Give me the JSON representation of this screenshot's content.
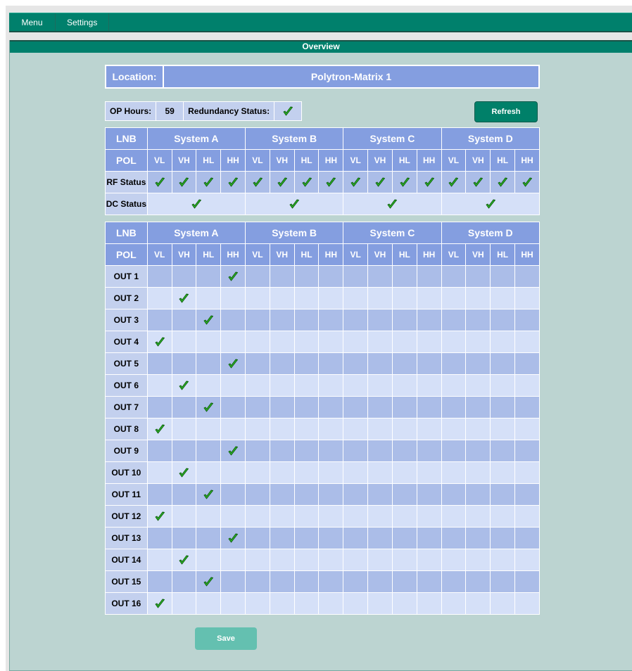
{
  "menu": {
    "items": [
      "Menu",
      "Settings"
    ]
  },
  "panel": {
    "title": "Overview"
  },
  "location": {
    "label": "Location:",
    "value": "Polytron-Matrix 1"
  },
  "info": {
    "op_hours_label": "OP Hours:",
    "op_hours_value": "59",
    "redundancy_label": "Redundancy Status:",
    "redundancy_ok": true,
    "refresh_label": "Refresh"
  },
  "systems": [
    "System A",
    "System B",
    "System C",
    "System D"
  ],
  "pols": [
    "VL",
    "VH",
    "HL",
    "HH"
  ],
  "labels": {
    "lnb": "LNB",
    "pol": "POL",
    "rf_status": "RF Status",
    "dc_status": "DC Status"
  },
  "rf_status": [
    [
      true,
      true,
      true,
      true
    ],
    [
      true,
      true,
      true,
      true
    ],
    [
      true,
      true,
      true,
      true
    ],
    [
      true,
      true,
      true,
      true
    ]
  ],
  "dc_status": [
    true,
    true,
    true,
    true
  ],
  "outputs": [
    {
      "label": "OUT 1",
      "system": 0,
      "pol": 3
    },
    {
      "label": "OUT 2",
      "system": 0,
      "pol": 1
    },
    {
      "label": "OUT 3",
      "system": 0,
      "pol": 2
    },
    {
      "label": "OUT 4",
      "system": 0,
      "pol": 0
    },
    {
      "label": "OUT 5",
      "system": 0,
      "pol": 3
    },
    {
      "label": "OUT 6",
      "system": 0,
      "pol": 1
    },
    {
      "label": "OUT 7",
      "system": 0,
      "pol": 2
    },
    {
      "label": "OUT 8",
      "system": 0,
      "pol": 0
    },
    {
      "label": "OUT 9",
      "system": 0,
      "pol": 3
    },
    {
      "label": "OUT 10",
      "system": 0,
      "pol": 1
    },
    {
      "label": "OUT 11",
      "system": 0,
      "pol": 2
    },
    {
      "label": "OUT 12",
      "system": 0,
      "pol": 0
    },
    {
      "label": "OUT 13",
      "system": 0,
      "pol": 3
    },
    {
      "label": "OUT 14",
      "system": 0,
      "pol": 1
    },
    {
      "label": "OUT 15",
      "system": 0,
      "pol": 2
    },
    {
      "label": "OUT 16",
      "system": 0,
      "pol": 0
    }
  ],
  "save_label": "Save",
  "icons": {
    "check": "green-check-icon"
  },
  "colors": {
    "accent": "#00806c",
    "header_blue": "#849ee0",
    "check_green": "#2fb62a"
  }
}
